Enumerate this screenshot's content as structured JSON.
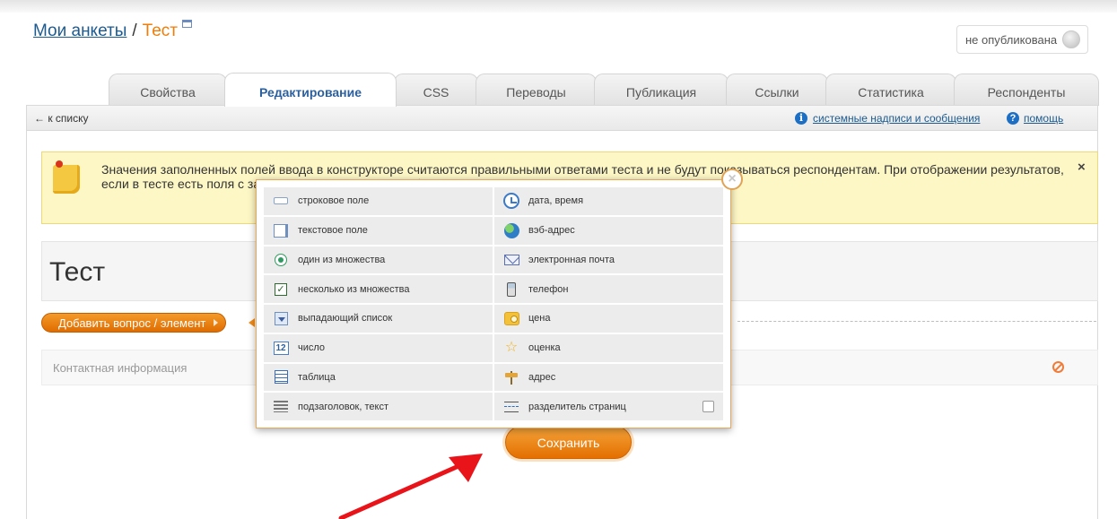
{
  "breadcrumb": {
    "root": "Мои анкеты",
    "separator": "/",
    "current": "Тест"
  },
  "status": {
    "label": "не опубликована"
  },
  "tabs": [
    {
      "label": "Свойства",
      "active": false
    },
    {
      "label": "Редактирование",
      "active": true
    },
    {
      "label": "CSS",
      "active": false
    },
    {
      "label": "Переводы",
      "active": false
    },
    {
      "label": "Публикация",
      "active": false
    },
    {
      "label": "Ссылки",
      "active": false
    },
    {
      "label": "Статистика",
      "active": false
    },
    {
      "label": "Респонденты",
      "active": false
    }
  ],
  "subbar": {
    "back": "← к списку",
    "system_messages": "системные надписи и сообщения",
    "help": "помощь"
  },
  "notice": {
    "text": "Значения заполненных полей ввода в конструкторе считаются правильными ответами теста и не будут показываться респондентам. При отображении результатов, если в тесте есть поля с заполненными значениями, будут высчитываться процент правильных ответов.",
    "close": "×"
  },
  "survey": {
    "title": "Тест"
  },
  "add_button": {
    "label": "Добавить вопрос / элемент"
  },
  "contact_row": {
    "label": "Контактная информация"
  },
  "save_button": {
    "label": "Сохранить"
  },
  "popup": {
    "close": "×",
    "items": [
      {
        "label": "строковое поле",
        "icon": "text-line-icon"
      },
      {
        "label": "дата, время",
        "icon": "clock-icon"
      },
      {
        "label": "текстовое поле",
        "icon": "textarea-icon"
      },
      {
        "label": "вэб-адрес",
        "icon": "globe-icon"
      },
      {
        "label": "один из множества",
        "icon": "radio-icon"
      },
      {
        "label": "электронная почта",
        "icon": "mail-icon"
      },
      {
        "label": "несколько из множества",
        "icon": "checkbox-icon"
      },
      {
        "label": "телефон",
        "icon": "phone-icon"
      },
      {
        "label": "выпадающий список",
        "icon": "dropdown-icon"
      },
      {
        "label": "цена",
        "icon": "price-icon"
      },
      {
        "label": "число",
        "icon": "number-icon"
      },
      {
        "label": "оценка",
        "icon": "star-icon"
      },
      {
        "label": "таблица",
        "icon": "table-icon"
      },
      {
        "label": "адрес",
        "icon": "signpost-icon"
      },
      {
        "label": "подзаголовок, текст",
        "icon": "heading-icon"
      },
      {
        "label": "разделитель страниц",
        "icon": "page-divider-icon"
      }
    ]
  },
  "colors": {
    "accent": "#f07c0a",
    "link": "#1d5a8e",
    "arrow": "#e8141a"
  }
}
